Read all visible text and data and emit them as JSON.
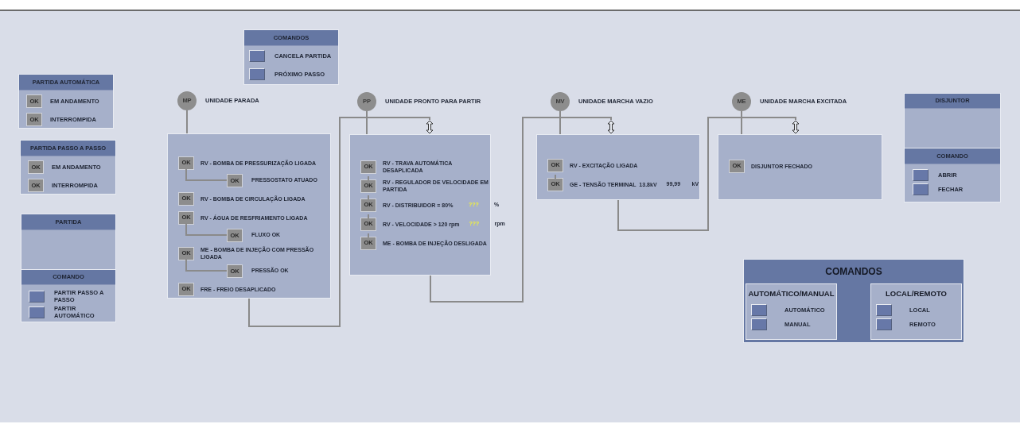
{
  "status_panels": [
    {
      "title": "PARTIDA AUTOMÁTICA",
      "items": [
        {
          "indicator": "OK",
          "label": "EM ANDAMENTO"
        },
        {
          "indicator": "OK",
          "label": "INTERROMPIDA"
        }
      ]
    },
    {
      "title": "PARTIDA PASSO A PASSO",
      "items": [
        {
          "indicator": "OK",
          "label": "EM ANDAMENTO"
        },
        {
          "indicator": "OK",
          "label": "INTERROMPIDA"
        }
      ]
    }
  ],
  "partida_panel": {
    "title": "PARTIDA",
    "command_title": "COMANDO",
    "buttons": [
      "PARTIR PASSO A PASSO",
      "PARTIR AUTOMÁTICO"
    ]
  },
  "top_commands": {
    "title": "COMANDOS",
    "buttons": [
      "CANCELA PARTIDA",
      "PRÓXIMO PASSO"
    ]
  },
  "stages": [
    {
      "code": "MP",
      "label": "UNIDADE PARADA",
      "conditions": [
        {
          "indicator": "OK",
          "text": "RV - BOMBA DE PRESSURIZAÇÃO LIGADA",
          "children": [
            {
              "indicator": "OK",
              "text": "PRESSOSTATO ATUADO"
            }
          ]
        },
        {
          "indicator": "OK",
          "text": "RV - BOMBA DE CIRCULAÇÃO LIGADA"
        },
        {
          "indicator": "OK",
          "text": "RV - ÁGUA DE RESFRIAMENTO LIGADA",
          "children": [
            {
              "indicator": "OK",
              "text": "FLUXO OK"
            }
          ]
        },
        {
          "indicator": "OK",
          "text": "ME - BOMBA DE INJEÇÃO COM PRESSÃO LIGADA",
          "children": [
            {
              "indicator": "OK",
              "text": "PRESSÃO OK"
            }
          ]
        },
        {
          "indicator": "OK",
          "text": "FRE - FREIO DESAPLICADO"
        }
      ]
    },
    {
      "code": "PP",
      "label": "UNIDADE PRONTO PARA PARTIR",
      "conditions": [
        {
          "indicator": "OK",
          "text": "RV - TRAVA AUTOMÁTICA DESAPLICADA"
        },
        {
          "indicator": "OK",
          "text": "RV - REGULADOR DE VELOCIDADE EM PARTIDA"
        },
        {
          "indicator": "OK",
          "text": "RV - DISTRIBUIDOR = 80%",
          "value": "???",
          "invalid": true,
          "unit": "%"
        },
        {
          "indicator": "OK",
          "text": "RV - VELOCIDADE > 120 rpm",
          "value": "???",
          "invalid": true,
          "unit": "rpm"
        },
        {
          "indicator": "OK",
          "text": "ME - BOMBA DE INJEÇÃO DESLIGADA"
        }
      ]
    },
    {
      "code": "MV",
      "label": "UNIDADE MARCHA VAZIO",
      "conditions": [
        {
          "indicator": "OK",
          "text": "RV - EXCITAÇÃO LIGADA"
        },
        {
          "indicator": "OK",
          "text": "GE - TENSÃO TERMINAL  13.8kV",
          "value": "99,99",
          "invalid": false,
          "unit": "kV"
        }
      ]
    },
    {
      "code": "ME",
      "label": "UNIDADE MARCHA EXCITADA",
      "conditions": [
        {
          "indicator": "OK",
          "text": "DISJUNTOR FECHADO"
        }
      ]
    }
  ],
  "disjuntor": {
    "title": "DISJUNTOR",
    "command_title": "COMANDO",
    "buttons": [
      "ABRIR",
      "FECHAR"
    ]
  },
  "mode_commands": {
    "title": "COMANDOS",
    "groups": [
      {
        "title": "AUTOMÁTICO/MANUAL",
        "buttons": [
          "AUTOMÁTICO",
          "MANUAL"
        ]
      },
      {
        "title": "LOCAL/REMOTO",
        "buttons": [
          "LOCAL",
          "REMOTO"
        ]
      }
    ]
  }
}
